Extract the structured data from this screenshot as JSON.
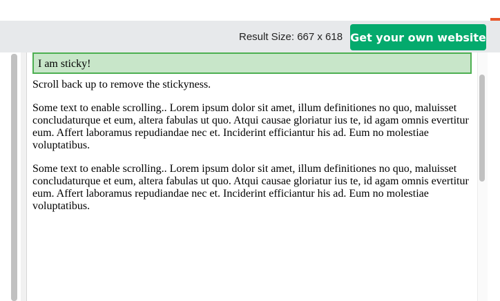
{
  "toolbar": {
    "result_size": "Result Size: 667 x 618",
    "get_website": "Get your own website"
  },
  "frame": {
    "sticky_text": "I am sticky!",
    "paragraphs": [
      "Scroll back up to remove the stickyness.",
      "Some text to enable scrolling.. Lorem ipsum dolor sit amet, illum definitiones no quo, maluisset concludaturque et eum, altera fabulas ut quo. Atqui causae gloriatur ius te, id agam omnis evertitur eum. Affert laboramus repudiandae nec et. Inciderint efficiantur his ad. Eum no molestiae voluptatibus.",
      "Some text to enable scrolling.. Lorem ipsum dolor sit amet, illum definitiones no quo, maluisset concludaturque et eum, altera fabulas ut quo. Atqui causae gloriatur ius te, id agam omnis evertitur eum. Affert laboramus repudiandae nec et. Inciderint efficiantur his ad. Eum no molestiae voluptatibus."
    ]
  },
  "colors": {
    "button_green": "#04aa6d",
    "sticky_bg": "#c8e6c9",
    "sticky_border": "#4caf50",
    "toolbar_bg": "#e7e9eb"
  }
}
